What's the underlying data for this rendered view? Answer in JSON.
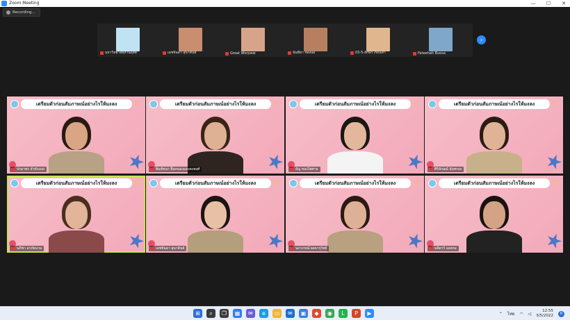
{
  "window": {
    "title": "Zoom Meeting",
    "controls": [
      "—",
      "☐",
      "✕"
    ]
  },
  "recording": {
    "label": "Recording..."
  },
  "thumbnails": [
    {
      "name": "มหาวิทยาลัยสวนดุสิต",
      "color": "#bfe3f2"
    },
    {
      "name": "เดชจินดา สุนาคินธ์",
      "color": "#c98d6f"
    },
    {
      "name": "Great Worpww",
      "color": "#d7a48a"
    },
    {
      "name": "นันทิยา ทองแผ",
      "color": "#b77f5f"
    },
    {
      "name": "03-5-อักษร เรือนคำ",
      "color": "#e0b68e"
    },
    {
      "name": "Fateehah Buesa",
      "color": "#7fa7c9"
    }
  ],
  "next_arrow": "›",
  "banner_text": "เตรียมตัวก่อนสัมภาษณ์อย่างไรให้มงลง",
  "participants": [
    {
      "name": "ปรมาพร ลำดับเนย",
      "skin": "#d9a584",
      "hair": "#2a1a12",
      "clothes": "#b8a184"
    },
    {
      "name": "พิมพ์ชนก ยิ้มหนองแดงคงพงศ์",
      "skin": "#deb094",
      "hair": "#3a2418",
      "clothes": "#2e2420"
    },
    {
      "name": "ธัญ ทองไพศาล",
      "skin": "#e2b79c",
      "hair": "#1c1714",
      "clothes": "#f4f4f4"
    },
    {
      "name": "ศิริลักษณ์ อัมพรเพ",
      "skin": "#e0b396",
      "hair": "#2a1c14",
      "clothes": "#c8b08a"
    },
    {
      "name": "นภิชา ลาภัยนาม",
      "skin": "#e2b49a",
      "hair": "#4a2e1e",
      "clothes": "#8a4a4a"
    },
    {
      "name": "เดชจินดา สุนาคินธ์",
      "skin": "#e8c0a6",
      "hair": "#1c1410",
      "clothes": "#b59e7c"
    },
    {
      "name": "นภาภรณ์ ผลจารุวิทย์",
      "skin": "#deb096",
      "hair": "#2c1a12",
      "clothes": "#b8a080"
    },
    {
      "name": "มลิตาร์ แสงกม",
      "skin": "#d4a285",
      "hair": "#1a1210",
      "clothes": "#222222"
    }
  ],
  "taskbar": {
    "icons": [
      {
        "name": "windows-start-icon",
        "color": "#2a6fdb",
        "glyph": "⊞"
      },
      {
        "name": "search-icon",
        "color": "#3a3a3a",
        "glyph": "⌕"
      },
      {
        "name": "task-view-icon",
        "color": "#3a3a3a",
        "glyph": "❐"
      },
      {
        "name": "widgets-icon",
        "color": "#2f7cf6",
        "glyph": "▦"
      },
      {
        "name": "chat-icon",
        "color": "#6b5bd6",
        "glyph": "✉"
      },
      {
        "name": "edge-icon",
        "color": "#1f9ae0",
        "glyph": "e"
      },
      {
        "name": "file-explorer-icon",
        "color": "#f2b631",
        "glyph": "▭"
      },
      {
        "name": "mail-icon",
        "color": "#1a6fd1",
        "glyph": "✉"
      },
      {
        "name": "store-icon",
        "color": "#3b7fd9",
        "glyph": "▣"
      },
      {
        "name": "office-icon",
        "color": "#e3462a",
        "glyph": "◆"
      },
      {
        "name": "chrome-icon",
        "color": "#3aa655",
        "glyph": "◉"
      },
      {
        "name": "line-icon",
        "color": "#21b34d",
        "glyph": "L"
      },
      {
        "name": "powerpoint-icon",
        "color": "#d24726",
        "glyph": "P"
      },
      {
        "name": "zoom-icon",
        "color": "#2d8cff",
        "glyph": "▶"
      }
    ],
    "tray_chevron": "⌃",
    "language": "ไทย",
    "time": "12:55",
    "date": "3/5/2022",
    "notifications": "6"
  }
}
